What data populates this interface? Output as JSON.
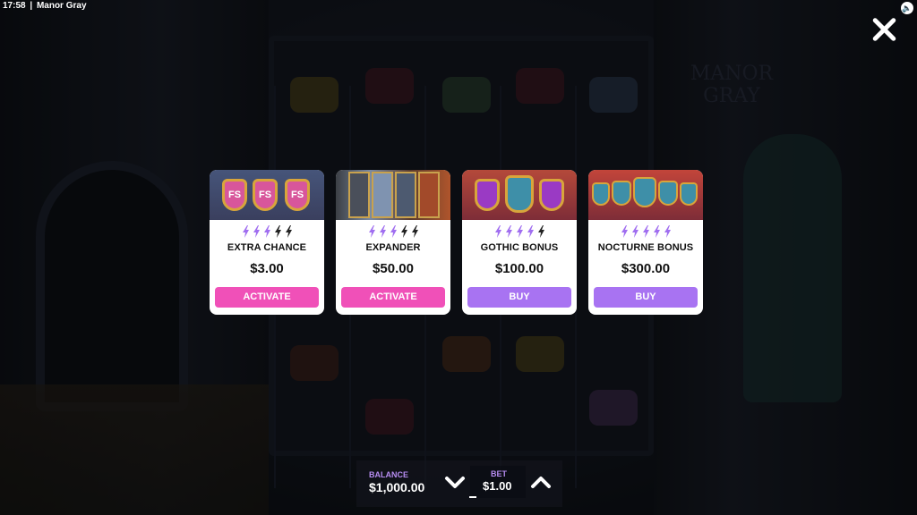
{
  "top_bar": {
    "time": "17:58",
    "separator": "|",
    "game_title": "Manor Gray"
  },
  "background": {
    "sign_text": "MANOR GRAY"
  },
  "cards": [
    {
      "art_icons": [
        "FS",
        "FS",
        "FS"
      ],
      "bolts_active": 3,
      "bolts_total": 5,
      "name": "EXTRA CHANCE",
      "price": "$3.00",
      "button": "ACTIVATE",
      "button_color": "#f050b8"
    },
    {
      "bolts_active": 3,
      "bolts_total": 5,
      "name": "EXPANDER",
      "price": "$50.00",
      "button": "ACTIVATE",
      "button_color": "#f050b8"
    },
    {
      "bolts_active": 4,
      "bolts_total": 5,
      "name": "GOTHIC BONUS",
      "price": "$100.00",
      "button": "BUY",
      "button_color": "#a873f2"
    },
    {
      "bolts_active": 5,
      "bolts_total": 5,
      "name": "NOCTURNE BONUS",
      "price": "$300.00",
      "button": "BUY",
      "button_color": "#a873f2"
    }
  ],
  "bottom_bar": {
    "balance_label": "BALANCE",
    "balance_value": "$1,000.00",
    "bet_label": "BET",
    "bet_value": "$1.00"
  },
  "colors": {
    "bolt_active": "#a06ef0",
    "bolt_inactive": "#222222",
    "label_purple": "#b68cf0"
  }
}
